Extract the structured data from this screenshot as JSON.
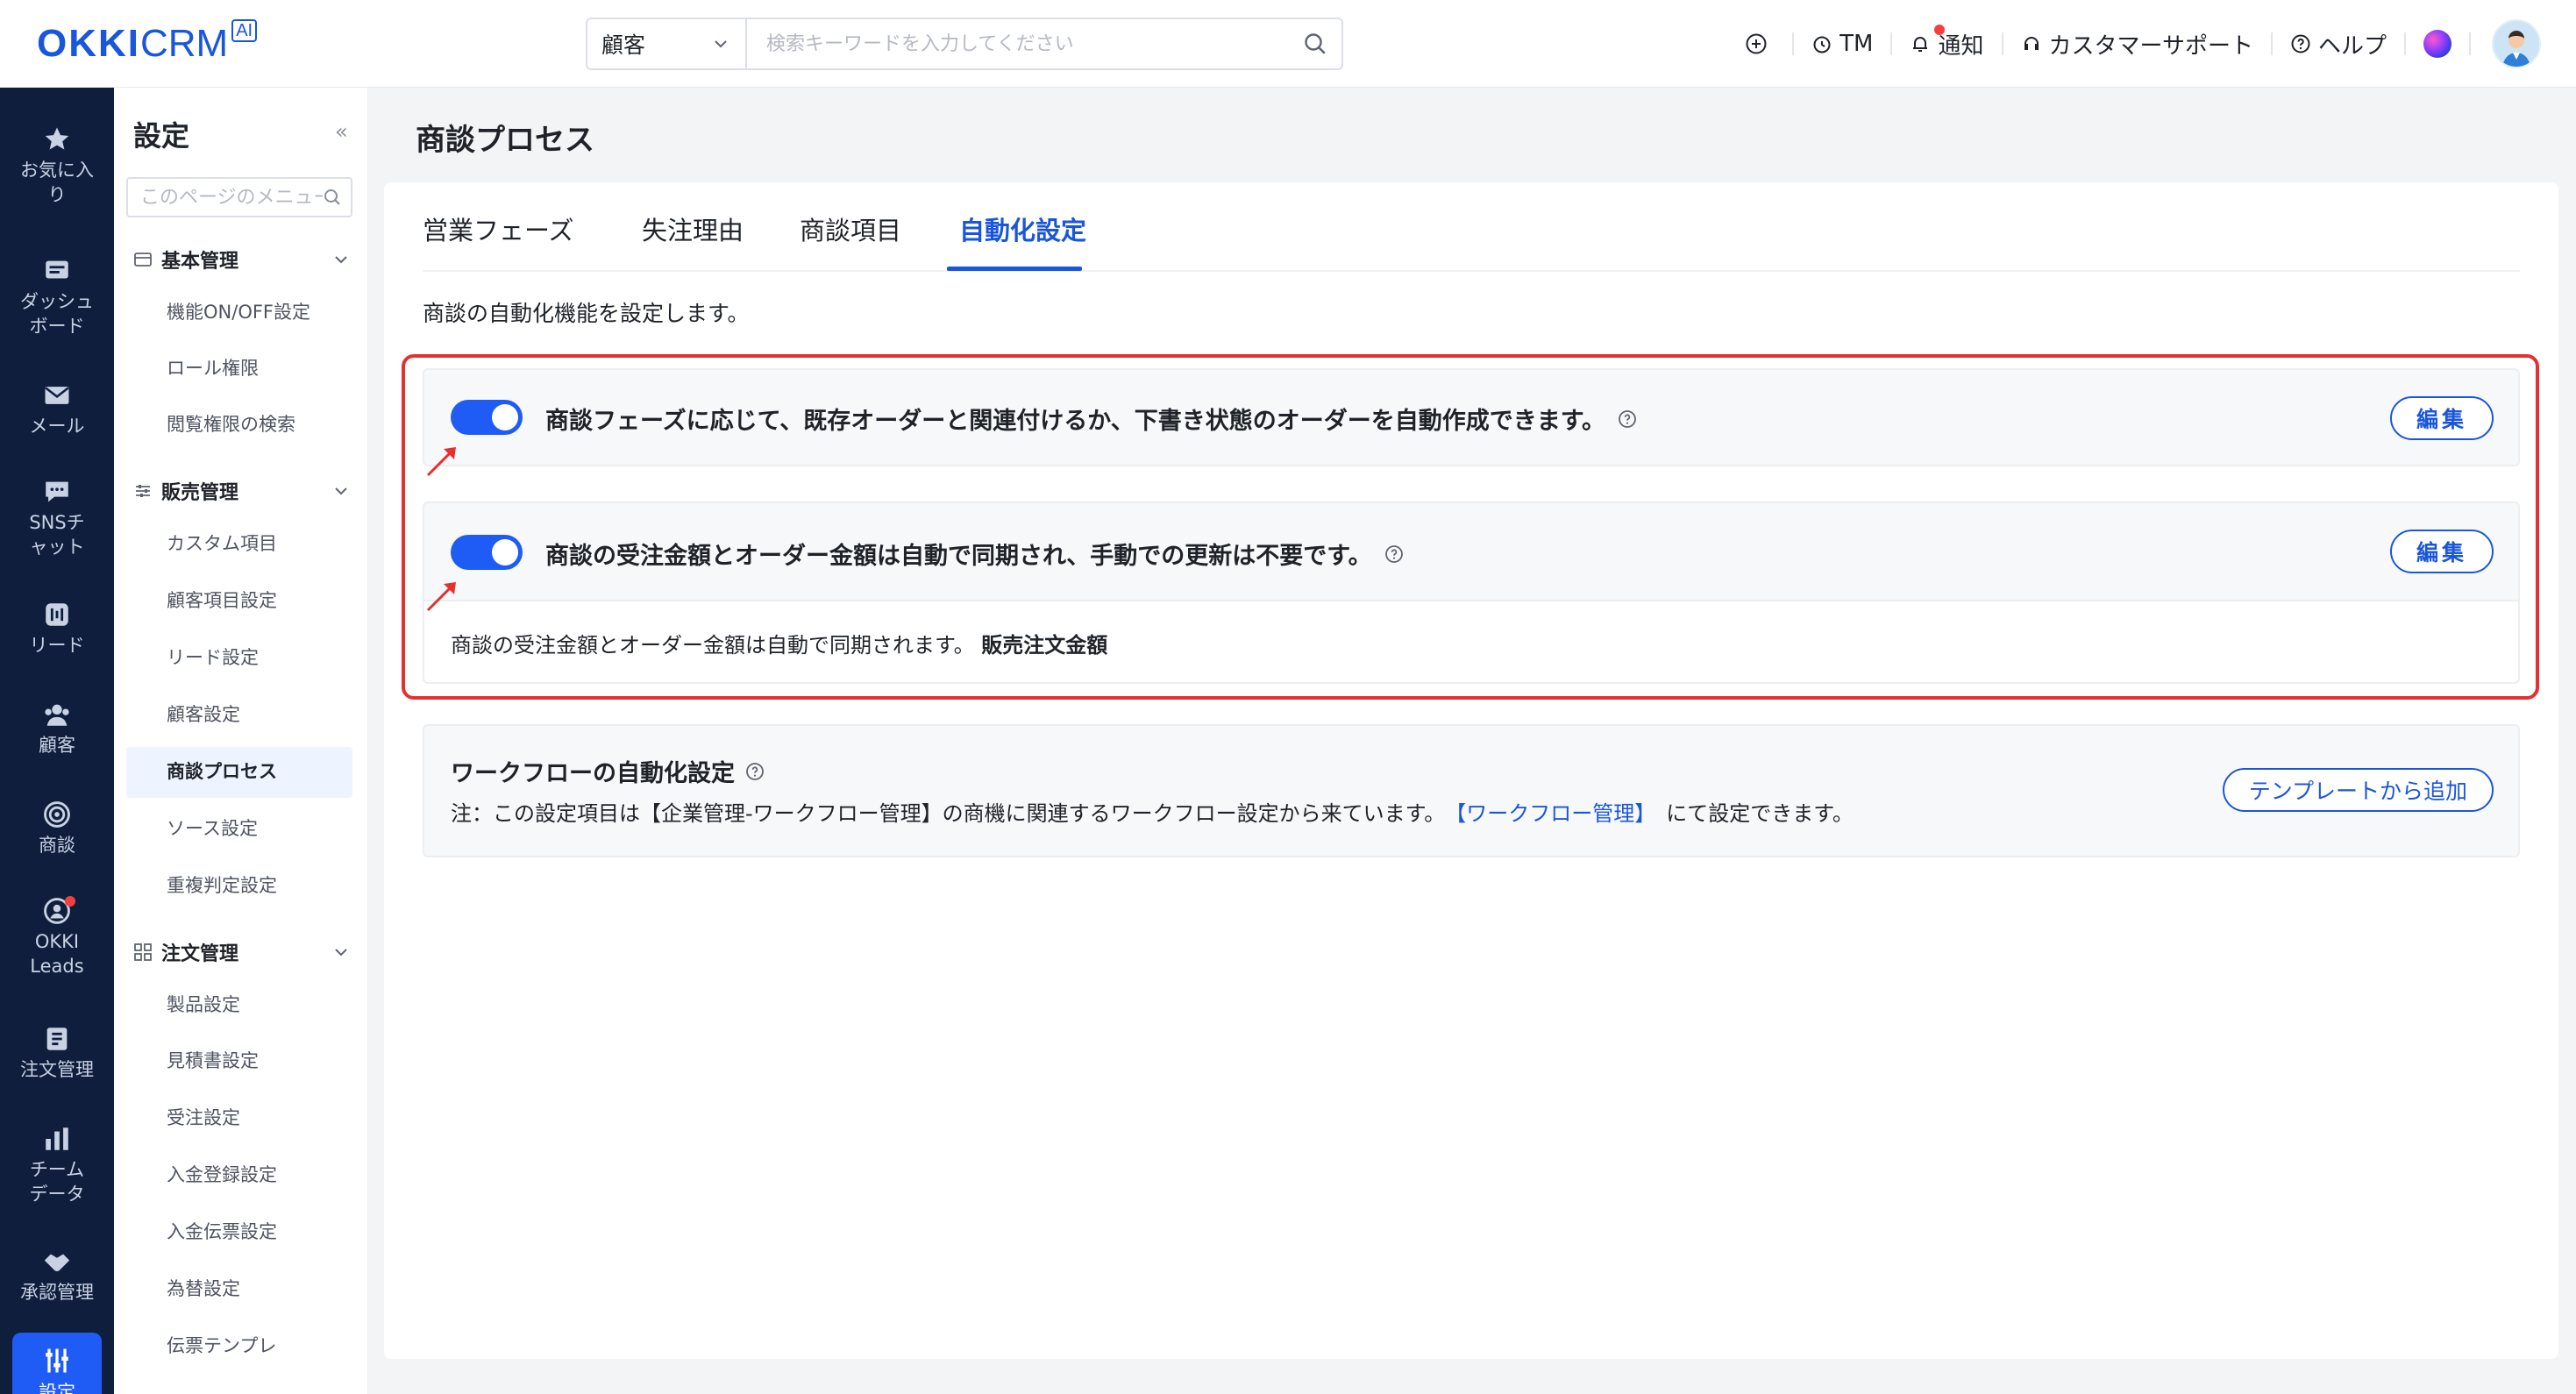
{
  "brand": {
    "logo_main": "OKKI",
    "logo_sub": "CRM",
    "logo_badge": "AI",
    "accent": "#1a56db"
  },
  "search": {
    "scope": "顧客",
    "placeholder": "検索キーワードを入力してください"
  },
  "header_actions": {
    "add_icon": "plus-circle-icon",
    "tm": "TM",
    "notice": "通知",
    "support": "カスタマーサポート",
    "help": "ヘルプ"
  },
  "rail": {
    "items": [
      {
        "label": "お気に入り",
        "icon": "star-icon"
      },
      {
        "label": "ダッシュボード",
        "icon": "dashboard-icon"
      },
      {
        "label": "メール",
        "icon": "mail-icon"
      },
      {
        "label": "SNSチャット",
        "icon": "chat-icon"
      },
      {
        "label": "リード",
        "icon": "lead-icon"
      },
      {
        "label": "顧客",
        "icon": "customers-icon"
      },
      {
        "label": "商談",
        "icon": "target-icon"
      },
      {
        "label": "OKKI Leads",
        "icon": "okki-leads-icon"
      },
      {
        "label": "注文管理",
        "icon": "document-icon"
      },
      {
        "label": "チームデータ",
        "icon": "bar-chart-icon"
      },
      {
        "label": "承認管理",
        "icon": "handshake-icon"
      },
      {
        "label": "設定",
        "icon": "sliders-icon"
      }
    ]
  },
  "sidebar": {
    "title": "設定",
    "search_placeholder": "このページのメニューを検索",
    "groups": [
      {
        "label": "基本管理",
        "items": [
          "機能ON/OFF設定",
          "ロール権限",
          "閲覧権限の検索"
        ]
      },
      {
        "label": "販売管理",
        "items": [
          "カスタム項目",
          "顧客項目設定",
          "リード設定",
          "顧客設定",
          "商談プロセス",
          "ソース設定",
          "重複判定設定"
        ]
      },
      {
        "label": "注文管理",
        "items": [
          "製品設定",
          "見積書設定",
          "受注設定",
          "入金登録設定",
          "入金伝票設定",
          "為替設定",
          "伝票テンプレ"
        ]
      }
    ],
    "active_item": "商談プロセス"
  },
  "main": {
    "title": "商談プロセス",
    "tabs": [
      "営業フェーズ",
      "失注理由",
      "商談項目",
      "自動化設定"
    ],
    "active_tab": "自動化設定",
    "description": "商談の自動化機能を設定します。",
    "rules": [
      {
        "text": "商談フェーズに応じて、既存オーダーと関連付けるか、下書き状態のオーダーを自動作成できます。",
        "enabled": true,
        "edit_label": "編集"
      },
      {
        "text": "商談の受注金額とオーダー金額は自動で同期され、手動での更新は不要です。",
        "enabled": true,
        "edit_label": "編集",
        "detail": "商談の受注金額とオーダー金額は自動で同期されます。",
        "detail_bold": "販売注文金額"
      }
    ],
    "workflow": {
      "title": "ワークフローの自動化設定",
      "note_prefix": "注：この設定項目は【企業管理-ワークフロー管理】の商機に関連するワークフロー設定から来ています。",
      "note_link": "【ワークフロー管理】",
      "note_suffix": "にて設定できます。",
      "button": "テンプレートから追加"
    }
  },
  "colors": {
    "highlight": "#e5302f",
    "toggle_on": "#1f5cf5",
    "rail_bg": "#0f1e3d"
  }
}
